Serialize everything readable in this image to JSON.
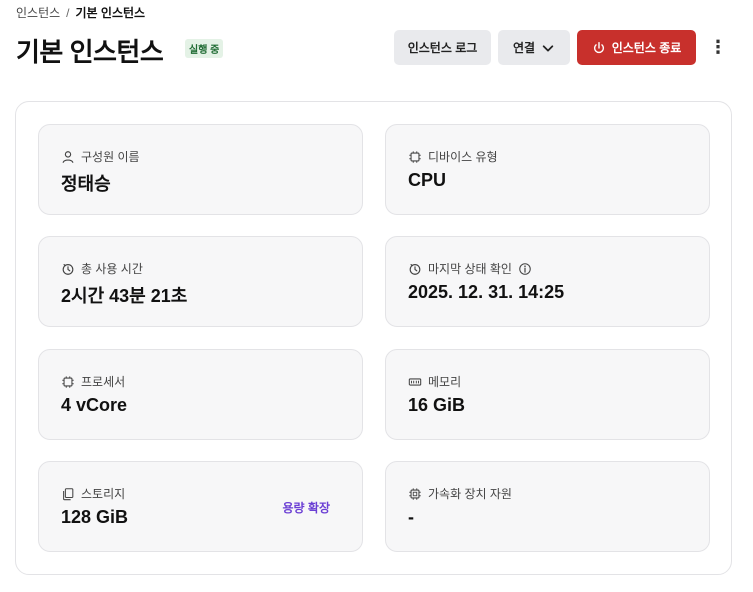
{
  "breadcrumb": {
    "parent": "인스턴스",
    "separator": "/",
    "current": "기본 인스턴스"
  },
  "header": {
    "title": "기본 인스턴스",
    "status": "실행 중",
    "logs_label": "인스턴스 로그",
    "connect_label": "연결",
    "stop_label": "인스턴스 종료",
    "more_icon": "⋮"
  },
  "cards": [
    {
      "icon": "user-icon",
      "label": "구성원 이름",
      "value": "정태승"
    },
    {
      "icon": "chip-icon",
      "label": "디바이스 유형",
      "value": "CPU"
    },
    {
      "icon": "timer-icon",
      "label": "총 사용 시간",
      "value": "2시간 43분 21초"
    },
    {
      "icon": "timer-icon",
      "label": "마지막 상태 확인",
      "value": "2025. 12. 31. 14:25"
    },
    {
      "icon": "chip-icon",
      "label": "프로세서",
      "value": "4 vCore"
    },
    {
      "icon": "memory-icon",
      "label": "메모리",
      "value": "16 GiB"
    },
    {
      "icon": "storage-icon",
      "label": "스토리지",
      "value": "128 GiB",
      "action": "용량 확장"
    },
    {
      "icon": "accelerator-icon",
      "label": "가속화 장치 자원",
      "value": "-"
    }
  ],
  "colors": {
    "primary_danger": "#c8302c",
    "status_bg": "#e4f2e6",
    "status_text": "#1f6b33",
    "action_link": "#6b3fd4"
  }
}
